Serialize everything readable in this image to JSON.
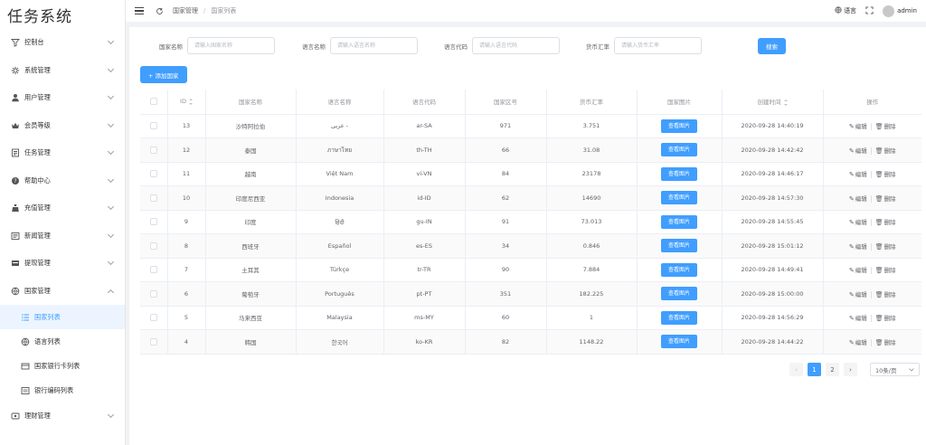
{
  "app": {
    "title": "任务系统"
  },
  "header": {
    "breadcrumb": [
      "国家管理",
      "国家列表"
    ],
    "lang_label": "语言",
    "username": "admin"
  },
  "sidebar": {
    "items": [
      {
        "label": "控制台",
        "icon": "funnel-icon"
      },
      {
        "label": "系统管理",
        "icon": "gear-icon"
      },
      {
        "label": "用户管理",
        "icon": "user-icon"
      },
      {
        "label": "会员等级",
        "icon": "crown-icon"
      },
      {
        "label": "任务管理",
        "icon": "task-icon"
      },
      {
        "label": "帮助中心",
        "icon": "help-icon"
      },
      {
        "label": "充值管理",
        "icon": "recharge-icon"
      },
      {
        "label": "新闻管理",
        "icon": "news-icon"
      },
      {
        "label": "提现管理",
        "icon": "withdraw-icon"
      },
      {
        "label": "国家管理",
        "icon": "globe-icon"
      }
    ],
    "submenu": [
      {
        "label": "国家列表",
        "icon": "list-icon",
        "active": true
      },
      {
        "label": "语言列表",
        "icon": "globe-icon",
        "active": false
      },
      {
        "label": "国家银行卡列表",
        "icon": "card-icon",
        "active": false
      },
      {
        "label": "银行编码列表",
        "icon": "code-icon",
        "active": false
      }
    ],
    "last_item": {
      "label": "理财管理",
      "icon": "finance-icon"
    }
  },
  "search": {
    "country_label": "国家名称",
    "country_placeholder": "请输入国家名称",
    "langname_label": "语言名称",
    "langname_placeholder": "请输入语言名称",
    "langcode_label": "语言代码",
    "langcode_placeholder": "请输入语言代码",
    "rate_label": "货币汇率",
    "rate_placeholder": "请输入货币汇率",
    "button_label": "搜索"
  },
  "toolbar": {
    "add_label": "+ 添加国家"
  },
  "table": {
    "headers": [
      "ID",
      "国家名称",
      "语言名称",
      "语言代码",
      "国家区号",
      "货币汇率",
      "国家图片",
      "创建时间",
      "操作"
    ],
    "view_label": "查看图片",
    "edit_label": "编辑",
    "delete_label": "删除",
    "rows": [
      {
        "id": "13",
        "country": "沙特阿拉伯",
        "lang": "عربى -",
        "code": "ar-SA",
        "area": "971",
        "rate": "3.751",
        "created": "2020-09-28 14:40:19"
      },
      {
        "id": "12",
        "country": "泰国",
        "lang": "ภาษาไทย",
        "code": "th-TH",
        "area": "66",
        "rate": "31.08",
        "created": "2020-09-28 14:42:42"
      },
      {
        "id": "11",
        "country": "越南",
        "lang": "Việt Nam",
        "code": "vi-VN",
        "area": "84",
        "rate": "23178",
        "created": "2020-09-28 14:46:17"
      },
      {
        "id": "10",
        "country": "印度尼西亚",
        "lang": "Indonesia",
        "code": "id-ID",
        "area": "62",
        "rate": "14690",
        "created": "2020-09-28 14:57:30"
      },
      {
        "id": "9",
        "country": "印度",
        "lang": "हिंदी",
        "code": "gu-IN",
        "area": "91",
        "rate": "73.013",
        "created": "2020-09-28 14:55:45"
      },
      {
        "id": "8",
        "country": "西班牙",
        "lang": "Español",
        "code": "es-ES",
        "area": "34",
        "rate": "0.846",
        "created": "2020-09-28 15:01:12"
      },
      {
        "id": "7",
        "country": "土耳其",
        "lang": "Türkçe",
        "code": "tr-TR",
        "area": "90",
        "rate": "7.884",
        "created": "2020-09-28 14:49:41"
      },
      {
        "id": "6",
        "country": "葡萄牙",
        "lang": "Português",
        "code": "pt-PT",
        "area": "351",
        "rate": "182.225",
        "created": "2020-09-28 15:00:00"
      },
      {
        "id": "5",
        "country": "马来西亚",
        "lang": "Malaysia",
        "code": "ms-MY",
        "area": "60",
        "rate": "1",
        "created": "2020-09-28 14:56:29"
      },
      {
        "id": "4",
        "country": "韩国",
        "lang": "한국어",
        "code": "ko-KR",
        "area": "82",
        "rate": "1148.22",
        "created": "2020-09-28 14:44:22"
      }
    ]
  },
  "pagination": {
    "prev": "‹",
    "pages": [
      "1",
      "2"
    ],
    "current": "1",
    "next": "›",
    "page_size": "10条/页"
  },
  "colors": {
    "primary": "#409eff",
    "active_bg": "#ecf5ff"
  }
}
